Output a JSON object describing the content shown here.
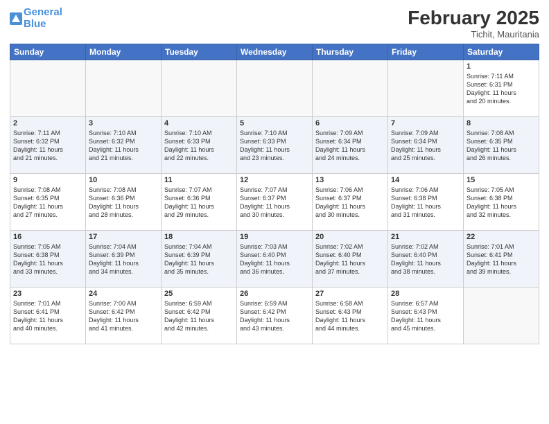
{
  "header": {
    "logo_line1": "General",
    "logo_line2": "Blue",
    "month": "February 2025",
    "location": "Tichit, Mauritania"
  },
  "days_of_week": [
    "Sunday",
    "Monday",
    "Tuesday",
    "Wednesday",
    "Thursday",
    "Friday",
    "Saturday"
  ],
  "weeks": [
    [
      {
        "day": "",
        "info": ""
      },
      {
        "day": "",
        "info": ""
      },
      {
        "day": "",
        "info": ""
      },
      {
        "day": "",
        "info": ""
      },
      {
        "day": "",
        "info": ""
      },
      {
        "day": "",
        "info": ""
      },
      {
        "day": "1",
        "info": "Sunrise: 7:11 AM\nSunset: 6:31 PM\nDaylight: 11 hours\nand 20 minutes."
      }
    ],
    [
      {
        "day": "2",
        "info": "Sunrise: 7:11 AM\nSunset: 6:32 PM\nDaylight: 11 hours\nand 21 minutes."
      },
      {
        "day": "3",
        "info": "Sunrise: 7:10 AM\nSunset: 6:32 PM\nDaylight: 11 hours\nand 21 minutes."
      },
      {
        "day": "4",
        "info": "Sunrise: 7:10 AM\nSunset: 6:33 PM\nDaylight: 11 hours\nand 22 minutes."
      },
      {
        "day": "5",
        "info": "Sunrise: 7:10 AM\nSunset: 6:33 PM\nDaylight: 11 hours\nand 23 minutes."
      },
      {
        "day": "6",
        "info": "Sunrise: 7:09 AM\nSunset: 6:34 PM\nDaylight: 11 hours\nand 24 minutes."
      },
      {
        "day": "7",
        "info": "Sunrise: 7:09 AM\nSunset: 6:34 PM\nDaylight: 11 hours\nand 25 minutes."
      },
      {
        "day": "8",
        "info": "Sunrise: 7:08 AM\nSunset: 6:35 PM\nDaylight: 11 hours\nand 26 minutes."
      }
    ],
    [
      {
        "day": "9",
        "info": "Sunrise: 7:08 AM\nSunset: 6:35 PM\nDaylight: 11 hours\nand 27 minutes."
      },
      {
        "day": "10",
        "info": "Sunrise: 7:08 AM\nSunset: 6:36 PM\nDaylight: 11 hours\nand 28 minutes."
      },
      {
        "day": "11",
        "info": "Sunrise: 7:07 AM\nSunset: 6:36 PM\nDaylight: 11 hours\nand 29 minutes."
      },
      {
        "day": "12",
        "info": "Sunrise: 7:07 AM\nSunset: 6:37 PM\nDaylight: 11 hours\nand 30 minutes."
      },
      {
        "day": "13",
        "info": "Sunrise: 7:06 AM\nSunset: 6:37 PM\nDaylight: 11 hours\nand 30 minutes."
      },
      {
        "day": "14",
        "info": "Sunrise: 7:06 AM\nSunset: 6:38 PM\nDaylight: 11 hours\nand 31 minutes."
      },
      {
        "day": "15",
        "info": "Sunrise: 7:05 AM\nSunset: 6:38 PM\nDaylight: 11 hours\nand 32 minutes."
      }
    ],
    [
      {
        "day": "16",
        "info": "Sunrise: 7:05 AM\nSunset: 6:38 PM\nDaylight: 11 hours\nand 33 minutes."
      },
      {
        "day": "17",
        "info": "Sunrise: 7:04 AM\nSunset: 6:39 PM\nDaylight: 11 hours\nand 34 minutes."
      },
      {
        "day": "18",
        "info": "Sunrise: 7:04 AM\nSunset: 6:39 PM\nDaylight: 11 hours\nand 35 minutes."
      },
      {
        "day": "19",
        "info": "Sunrise: 7:03 AM\nSunset: 6:40 PM\nDaylight: 11 hours\nand 36 minutes."
      },
      {
        "day": "20",
        "info": "Sunrise: 7:02 AM\nSunset: 6:40 PM\nDaylight: 11 hours\nand 37 minutes."
      },
      {
        "day": "21",
        "info": "Sunrise: 7:02 AM\nSunset: 6:40 PM\nDaylight: 11 hours\nand 38 minutes."
      },
      {
        "day": "22",
        "info": "Sunrise: 7:01 AM\nSunset: 6:41 PM\nDaylight: 11 hours\nand 39 minutes."
      }
    ],
    [
      {
        "day": "23",
        "info": "Sunrise: 7:01 AM\nSunset: 6:41 PM\nDaylight: 11 hours\nand 40 minutes."
      },
      {
        "day": "24",
        "info": "Sunrise: 7:00 AM\nSunset: 6:42 PM\nDaylight: 11 hours\nand 41 minutes."
      },
      {
        "day": "25",
        "info": "Sunrise: 6:59 AM\nSunset: 6:42 PM\nDaylight: 11 hours\nand 42 minutes."
      },
      {
        "day": "26",
        "info": "Sunrise: 6:59 AM\nSunset: 6:42 PM\nDaylight: 11 hours\nand 43 minutes."
      },
      {
        "day": "27",
        "info": "Sunrise: 6:58 AM\nSunset: 6:43 PM\nDaylight: 11 hours\nand 44 minutes."
      },
      {
        "day": "28",
        "info": "Sunrise: 6:57 AM\nSunset: 6:43 PM\nDaylight: 11 hours\nand 45 minutes."
      },
      {
        "day": "",
        "info": ""
      }
    ]
  ]
}
